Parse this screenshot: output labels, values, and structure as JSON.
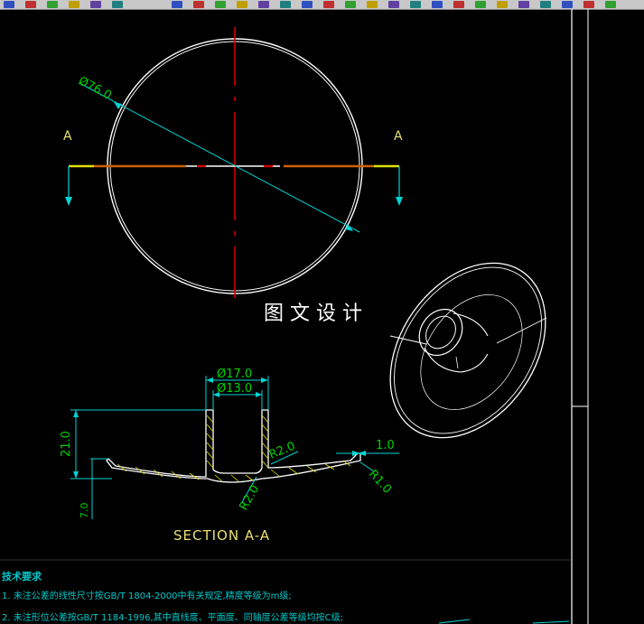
{
  "colors": {
    "background": "#000000",
    "outline": "#ffffff",
    "centerline": "#d00000",
    "dimension": "#00d4d4",
    "dim_text": "#00d400",
    "section_label": "#e8e070",
    "hatch": "#e0e000",
    "notes": "#00c8c8"
  },
  "toolbar": {
    "icons": [
      "layer-icon",
      "layer-icon",
      "layer-icon",
      "layer-icon",
      "layer-icon",
      "layer-icon",
      "properties-icon",
      "properties-icon",
      "color-icon",
      "linetype-icon",
      "lineweight-icon",
      "match-icon",
      "dim-icon",
      "dim-icon",
      "block-icon",
      "block-icon",
      "block-icon",
      "block-icon",
      "block-icon",
      "block-icon",
      "block-icon",
      "block-icon",
      "block-icon",
      "block-icon",
      "block-icon",
      "block-icon",
      "block-icon"
    ]
  },
  "top_view": {
    "diameter_label": "Ø76.0",
    "section_mark_left": "A",
    "section_mark_right": "A"
  },
  "watermark": "图 文 设 计",
  "section_view": {
    "dim_outer_dia": "Ø17.0",
    "dim_inner_dia": "Ø13.0",
    "dim_height": "21.0",
    "dim_base": "7.0",
    "dim_fillet_upper": "R2.0",
    "dim_fillet_lower": "R2.0",
    "dim_thickness": "1.0",
    "dim_edge_radius": "R1.0",
    "title": "SECTION A-A"
  },
  "notes": {
    "title": "技术要求",
    "line1": "1. 未注公差的线性尺寸按GB/T 1804-2000中有关规定,精度等级为m级;",
    "line2": "2. 未注形位公差按GB/T 1184-1996,其中直线度、平面度、同轴度公差等级均按C级;"
  }
}
